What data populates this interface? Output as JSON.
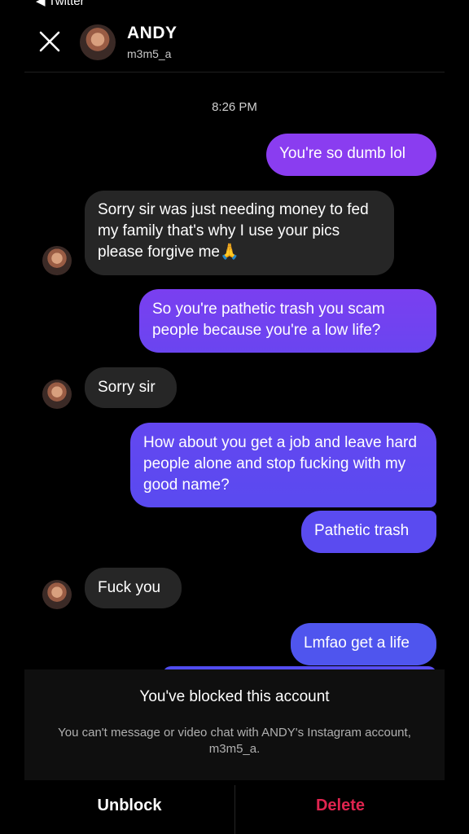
{
  "status_bar": {
    "back_label": "◀ Twitter"
  },
  "header": {
    "name": "ANDY",
    "username": "m3m5_a"
  },
  "timestamp": "8:26 PM",
  "messages": [
    {
      "side": "sent",
      "text": "You're so dumb lol"
    },
    {
      "side": "received",
      "text": "Sorry sir was just needing money to fed my family that's why I use your pics please forgive me🙏"
    },
    {
      "side": "sent",
      "text": "So you're pathetic trash you scam people because you're a low life?"
    },
    {
      "side": "received",
      "text": "Sorry sir"
    },
    {
      "side": "sent",
      "text": "How about you get a job and leave hard people alone and stop fucking with my good name?"
    },
    {
      "side": "sent",
      "text": "Pathetic trash"
    },
    {
      "side": "received",
      "text": "Fuck you"
    },
    {
      "side": "sent",
      "text": "Lmfao get a life"
    }
  ],
  "blocked": {
    "title": "You've blocked this account",
    "description": "You can't message or video chat with ANDY's Instagram account, m3m5_a."
  },
  "actions": {
    "unblock_label": "Unblock",
    "delete_label": "Delete"
  },
  "colors": {
    "sent_gradient_top": "#8a3df0",
    "sent_gradient_bottom": "#4f55ee",
    "received_bubble": "#262626",
    "delete_red": "#e0244f"
  }
}
